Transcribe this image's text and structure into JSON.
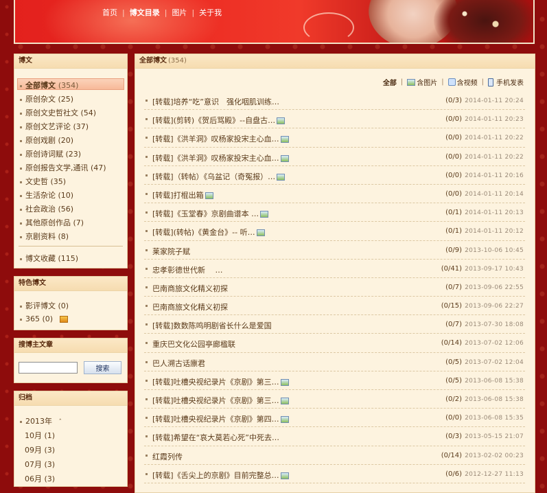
{
  "nav": {
    "items": [
      "首页",
      "博文目录",
      "图片",
      "关于我"
    ],
    "separator": "|"
  },
  "sidebar": {
    "blog_box": {
      "title": "博文",
      "categories": [
        {
          "label": "全部博文",
          "count": "(354)"
        },
        {
          "label": "原创杂文",
          "count": "(25)"
        },
        {
          "label": "原创文史哲社文",
          "count": "(54)"
        },
        {
          "label": "原创文艺评论",
          "count": "(37)"
        },
        {
          "label": "原创戏剧",
          "count": "(20)"
        },
        {
          "label": "原创诗词赋",
          "count": "(23)"
        },
        {
          "label": "原创报告文学,通讯",
          "count": "(47)"
        },
        {
          "label": "文史哲",
          "count": "(35)"
        },
        {
          "label": "生活杂论",
          "count": "(10)"
        },
        {
          "label": "社会政治",
          "count": "(56)"
        },
        {
          "label": "其他原创作品",
          "count": "(7)"
        },
        {
          "label": "京剧资料",
          "count": "(8)"
        }
      ],
      "favorites": {
        "label": "博文收藏",
        "count": "(115)"
      }
    },
    "featured_box": {
      "title": "特色博文",
      "items": [
        {
          "label": "影评博文",
          "count": "(0)"
        },
        {
          "label": "365",
          "count": "(0)"
        }
      ]
    },
    "search_box": {
      "title": "搜博主文章",
      "input_value": "",
      "button": "搜索"
    },
    "archive_box": {
      "title": "归档",
      "year": "2013年",
      "months": [
        "10月 (1)",
        "09月 (3)",
        "07月 (3)",
        "06月 (3)"
      ]
    }
  },
  "main": {
    "title": "全部博文",
    "count": "(354)",
    "filters": {
      "all": "全部",
      "with_pic": "含图片",
      "with_video": "含视频",
      "mobile": "手机发表",
      "separator": "|"
    },
    "posts": [
      {
        "title": "[转载]培养“吃”意识　强化咽肌训练…",
        "pic": false,
        "count": "(0/3)",
        "date": "2014-01-11 20:24"
      },
      {
        "title": "[转载](剪转)《贺后骂殿》--自盘古…",
        "pic": true,
        "count": "(0/0)",
        "date": "2014-01-11 20:23"
      },
      {
        "title": "[转载]《洪羊洞》叹杨家投宋主心血…",
        "pic": true,
        "count": "(0/0)",
        "date": "2014-01-11 20:22"
      },
      {
        "title": "[转载]《洪羊洞》叹杨家投宋主心血…",
        "pic": true,
        "count": "(0/0)",
        "date": "2014-01-11 20:22"
      },
      {
        "title": "[转载]（转帖）《乌盆记（奇冤报）…",
        "pic": true,
        "count": "(0/0)",
        "date": "2014-01-11 20:16"
      },
      {
        "title": "[转载]打棍出箱",
        "pic": true,
        "count": "(0/0)",
        "date": "2014-01-11 20:14"
      },
      {
        "title": "[转载]《玉堂春》京剧曲谱本 …",
        "pic": true,
        "count": "(0/1)",
        "date": "2014-01-11 20:13"
      },
      {
        "title": "[转载](转帖)《黄金台》-- 听…",
        "pic": true,
        "count": "(0/1)",
        "date": "2014-01-11 20:12"
      },
      {
        "title": "莱家院子赋",
        "pic": false,
        "count": "(0/9)",
        "date": "2013-10-06 10:45"
      },
      {
        "title": "忠孝彰德世代新　 …",
        "pic": false,
        "count": "(0/41)",
        "date": "2013-09-17 10:43"
      },
      {
        "title": "巴南商旅文化精义初探",
        "pic": false,
        "count": "(0/7)",
        "date": "2013-09-06 22:55"
      },
      {
        "title": "巴南商旅文化精义初探",
        "pic": false,
        "count": "(0/15)",
        "date": "2013-09-06 22:27"
      },
      {
        "title": "[转载]数数陈鸣明剧省长什么是爱国",
        "pic": false,
        "count": "(0/7)",
        "date": "2013-07-30 18:08"
      },
      {
        "title": "重庆巴文化公园亭廊楹联",
        "pic": false,
        "count": "(0/14)",
        "date": "2013-07-02 12:06"
      },
      {
        "title": "巴人溯古话廪君",
        "pic": false,
        "count": "(0/5)",
        "date": "2013-07-02 12:04"
      },
      {
        "title": "[转载]吐槽央视纪录片《京剧》第三…",
        "pic": true,
        "count": "(0/5)",
        "date": "2013-06-08 15:38"
      },
      {
        "title": "[转载]吐槽央视纪录片《京剧》第三…",
        "pic": true,
        "count": "(0/2)",
        "date": "2013-06-08 15:38"
      },
      {
        "title": "[转载]吐槽央视纪录片《京剧》第四…",
        "pic": true,
        "count": "(0/0)",
        "date": "2013-06-08 15:35"
      },
      {
        "title": "[转载]希望在“哀大莫若心死”中死去…",
        "pic": false,
        "count": "(0/3)",
        "date": "2013-05-15 21:07"
      },
      {
        "title": "红霞列传",
        "pic": false,
        "count": "(0/14)",
        "date": "2013-02-02 00:23"
      },
      {
        "title": "[转载]《舌尖上的京剧》目前完整总…",
        "pic": true,
        "count": "(0/6)",
        "date": "2012-12-27 11:13"
      }
    ]
  }
}
